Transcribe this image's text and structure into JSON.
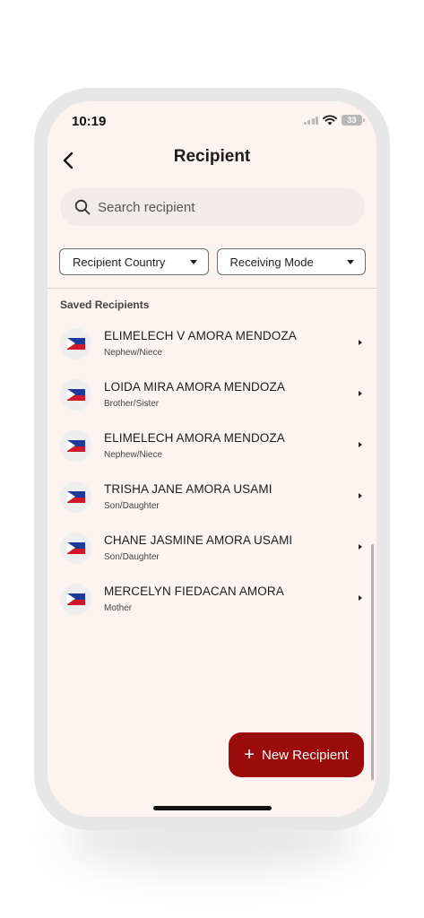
{
  "status_bar": {
    "time": "10:19",
    "battery": "33"
  },
  "header": {
    "title": "Recipient"
  },
  "search": {
    "placeholder": "Search recipient"
  },
  "filters": {
    "country_label": "Recipient Country",
    "mode_label": "Receiving Mode"
  },
  "section": {
    "label": "Saved Recipients"
  },
  "recipients": [
    {
      "name": "ELIMELECH V AMORA MENDOZA",
      "relation": "Nephew/Niece"
    },
    {
      "name": "LOIDA MIRA AMORA MENDOZA",
      "relation": "Brother/Sister"
    },
    {
      "name": "ELIMELECH AMORA MENDOZA",
      "relation": "Nephew/Niece"
    },
    {
      "name": "TRISHA JANE AMORA USAMI",
      "relation": "Son/Daughter"
    },
    {
      "name": "CHANE JASMINE AMORA USAMI",
      "relation": "Son/Daughter"
    },
    {
      "name": "MERCELYN FIEDACAN AMORA",
      "relation": "Mother"
    }
  ],
  "fab": {
    "label": "New Recipient"
  },
  "colors": {
    "accent": "#9b0b0b",
    "background": "#fdf3f1"
  },
  "icons": {
    "back": "chevron-left-icon",
    "search": "search-icon",
    "flag": "philippines-flag-icon"
  }
}
